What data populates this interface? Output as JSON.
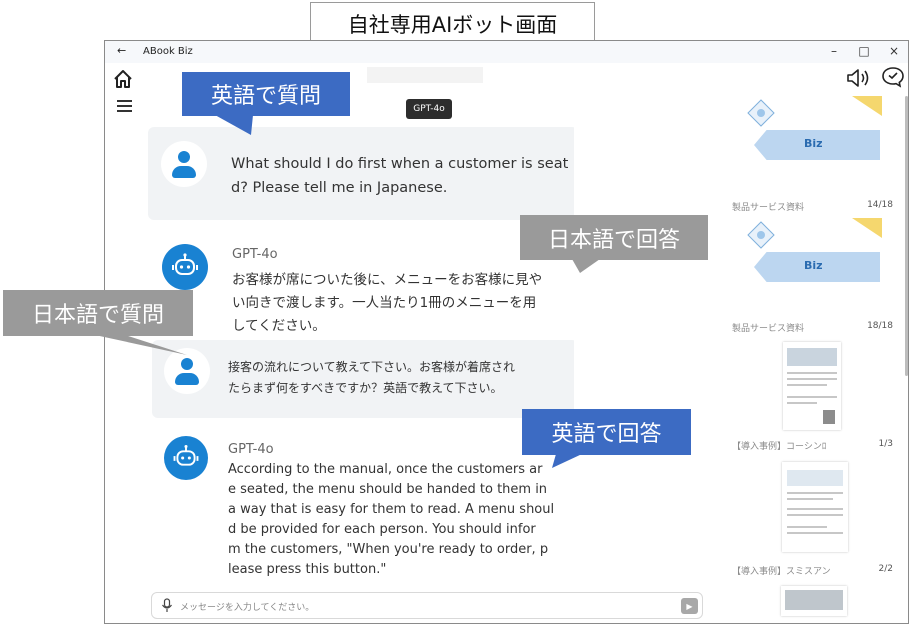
{
  "caption": "自社専用AIボット画面",
  "window": {
    "back_glyph": "←",
    "app_title": "ABook Biz",
    "controls": {
      "minimize": "–",
      "maximize": "□",
      "close": "×"
    }
  },
  "header": {
    "model_badge": "GPT-4o"
  },
  "chat": {
    "messages": [
      {
        "role": "user",
        "text": "What should I do first when a customer is seat\nd? Please tell me in Japanese."
      },
      {
        "role": "bot",
        "sender": "GPT-4o",
        "text": "お客様が席についた後に、メニューをお客様に見や\nい向きで渡します。一人当たり1冊のメニューを用\nしてください。"
      },
      {
        "role": "user",
        "text": "接客の流れについて教えて下さい。お客様が着席され\nたらまず何をすべきですか？英語で教えて下さい。"
      },
      {
        "role": "bot",
        "sender": "GPT-4o",
        "text": "According to the manual, once the customers ar\ne seated, the menu should be handed to them in\na way that is easy for them to read. A menu shoul\nd be provided for each person. You should infor\nm the customers, \"When you're ready to order, p\nlease press this button.\""
      }
    ],
    "input_placeholder": "メッセージを入力してください。"
  },
  "documents": [
    {
      "caption": "製品サービス資料",
      "page": "14/18"
    },
    {
      "caption": "製品サービス資料",
      "page": "18/18"
    },
    {
      "caption": "【導入事例】コーシンﾛ",
      "page": "1/3"
    },
    {
      "caption": "【導入事例】スミスアン",
      "page": "2/2"
    }
  ],
  "slide_brand": "Biz",
  "callouts": {
    "q_english": "英語で質問",
    "a_japanese": "日本語で回答",
    "q_japanese": "日本語で質問",
    "a_english": "英語で回答"
  },
  "colors": {
    "accent": "#1982d2",
    "callout_blue": "#3c6bc3",
    "callout_gray": "#9a9a9a",
    "bubble_bg": "#f1f3f5"
  }
}
